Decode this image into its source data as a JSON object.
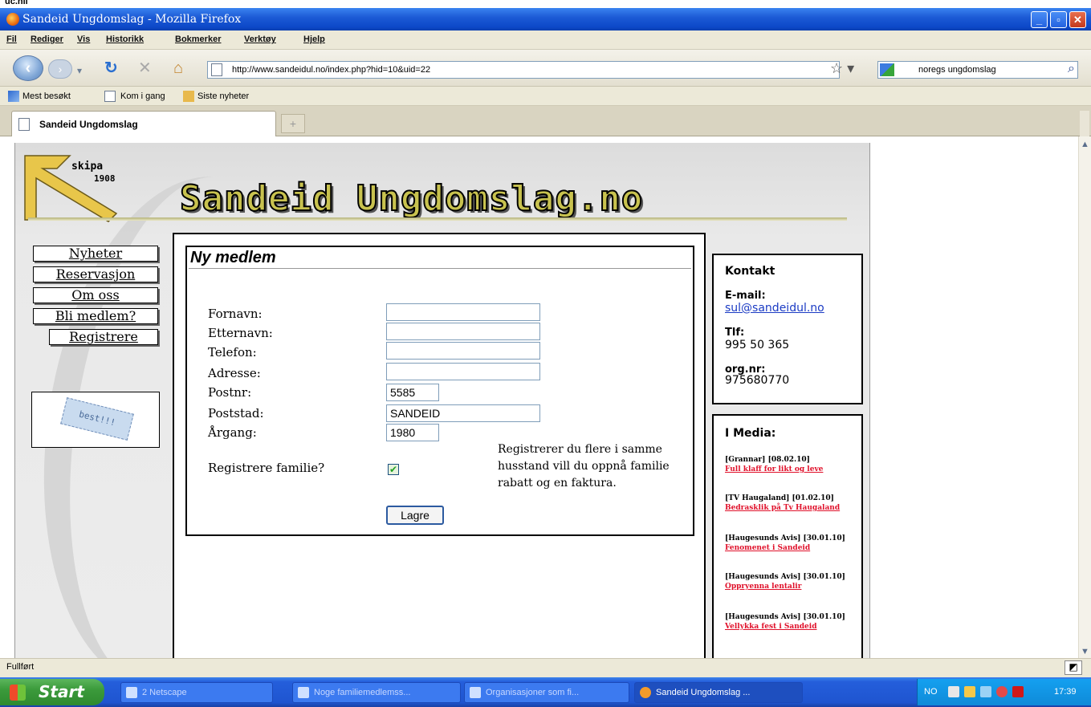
{
  "top_strip_text": "uc.nii",
  "window": {
    "title": "Sandeid Ungdomslag - Mozilla Firefox",
    "controls": {
      "minimize": "_",
      "maximize": "▫",
      "close": "✕"
    }
  },
  "menu": [
    "Fil",
    "Rediger",
    "Vis",
    "Historikk",
    "Bokmerker",
    "Verktøy",
    "Hjelp"
  ],
  "navbar": {
    "url": "http://www.sandeidul.no/index.php?hid=10&uid=22",
    "search_value": "noregs ungdomslag"
  },
  "bookmarks": [
    "Mest besøkt",
    "Kom i gang",
    "Siste nyheter"
  ],
  "tab": {
    "title": "Sandeid Ungdomslag",
    "newtab": "+"
  },
  "site": {
    "logo_text": "skipa",
    "logo_year": "1908",
    "title": "Sandeid Ungdomslag.no",
    "nav": [
      "Nyheter",
      "Reservasjon",
      "Om oss",
      "Bli medlem?",
      "Registrere"
    ],
    "badge_text": "best!!!"
  },
  "form": {
    "title": "Ny medlem",
    "fields": [
      {
        "label": "Fornavn:",
        "value": ""
      },
      {
        "label": "Etternavn:",
        "value": ""
      },
      {
        "label": "Telefon:",
        "value": ""
      },
      {
        "label": "Adresse:",
        "value": ""
      },
      {
        "label": "Postnr:",
        "value": "5585"
      },
      {
        "label": "Poststad:",
        "value": "SANDEID"
      },
      {
        "label": "Årgang:",
        "value": "1980"
      }
    ],
    "family_label": "Registrere familie?",
    "family_checked": true,
    "note": "Registrerer du flere i samme husstand vill du oppnå familie rabatt og en faktura.",
    "save": "Lagre"
  },
  "contact": {
    "title": "Kontakt",
    "email_label": "E-mail:",
    "email": "sul@sandeidul.no",
    "phone_label": "Tlf:",
    "phone": "995 50 365",
    "org_label": "org.nr:",
    "org": "975680770"
  },
  "media": {
    "title": "I Media:",
    "items": [
      {
        "date": "[Grannar] [08.02.10]",
        "link": "Full klaff for likt og leve"
      },
      {
        "date": "[TV Haugaland] [01.02.10]",
        "link": "Bedrasklik på Tv Haugaland"
      },
      {
        "date": "[Haugesunds Avis] [30.01.10]",
        "link": "Fenomenet i Sandeid"
      },
      {
        "date": "[Haugesunds Avis] [30.01.10]",
        "link": "Oppryenna lentalir"
      },
      {
        "date": "[Haugesunds Avis] [30.01.10]",
        "link": "Vellykka fest i Sandeid"
      }
    ]
  },
  "status": "Fullført",
  "taskbar": {
    "start": "Start",
    "buttons": [
      "2 Netscape",
      "Noge familiemedlemss...",
      "Organisasjoner som fi...",
      "Sandeid Ungdomslag ..."
    ],
    "tray_lang": "NO",
    "clock": "17:39"
  }
}
